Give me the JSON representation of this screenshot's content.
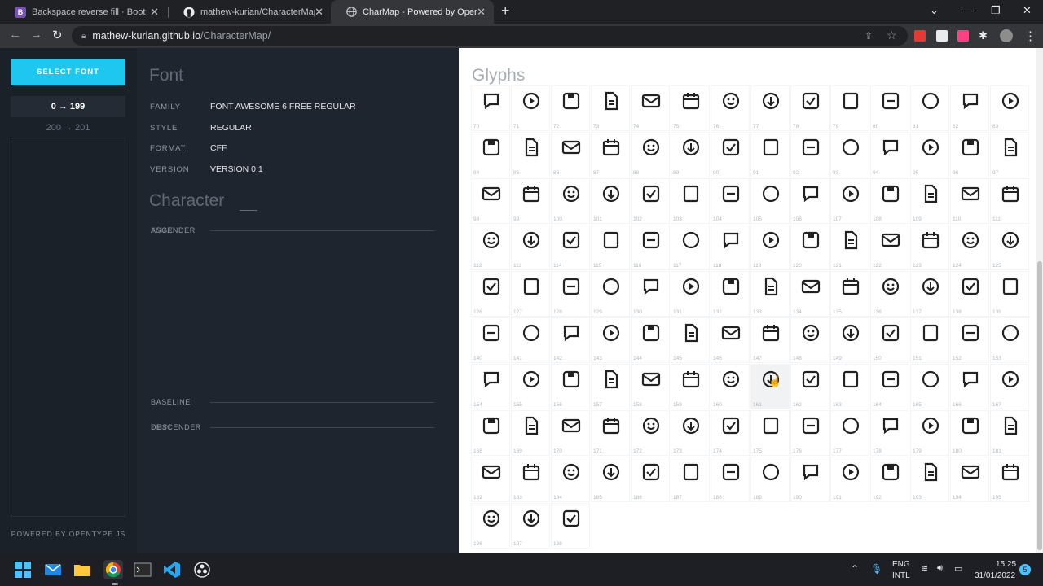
{
  "browser": {
    "tabs": [
      {
        "title": "Backspace reverse fill · Bootstrap",
        "icon": "bootstrap-icon",
        "color": "#7952b3",
        "letter": "B"
      },
      {
        "title": "mathew-kurian/CharacterMap: O",
        "icon": "github-icon",
        "color": "#ffffff",
        "letter": ""
      },
      {
        "title": "CharMap - Powered by OpenType",
        "icon": "globe-icon",
        "color": "#9aa0a6",
        "letter": ""
      }
    ],
    "url_host": "mathew-kurian.github.io",
    "url_path": "/CharacterMap/"
  },
  "sidebar": {
    "select_font": "SELECT FONT",
    "ranges": [
      "0 → 199",
      "200 → 201"
    ],
    "powered_by": "POWERED BY OPENTYPE.JS"
  },
  "font": {
    "heading": "Font",
    "props": [
      {
        "label": "FAMILY",
        "value": "FONT AWESOME 6 FREE REGULAR"
      },
      {
        "label": "STYLE",
        "value": "REGULAR"
      },
      {
        "label": "FORMAT",
        "value": "CFF"
      },
      {
        "label": "VERSION",
        "value": "VERSION 0.1"
      }
    ]
  },
  "character": {
    "heading": "Character",
    "metrics": {
      "ascender_top": "ASCENDER",
      "ascender_overlap": "YMAX",
      "baseline": "BASELINE",
      "descender": "DESCENDER",
      "descender_overlap": "YMIN"
    }
  },
  "glyphs": {
    "heading": "Glyphs",
    "start_index": 70,
    "count": 129,
    "hover_index": 161
  },
  "taskbar": {
    "lang1": "ENG",
    "lang2": "INTL",
    "time": "15:25",
    "date": "31/01/2022",
    "badge": "5"
  }
}
